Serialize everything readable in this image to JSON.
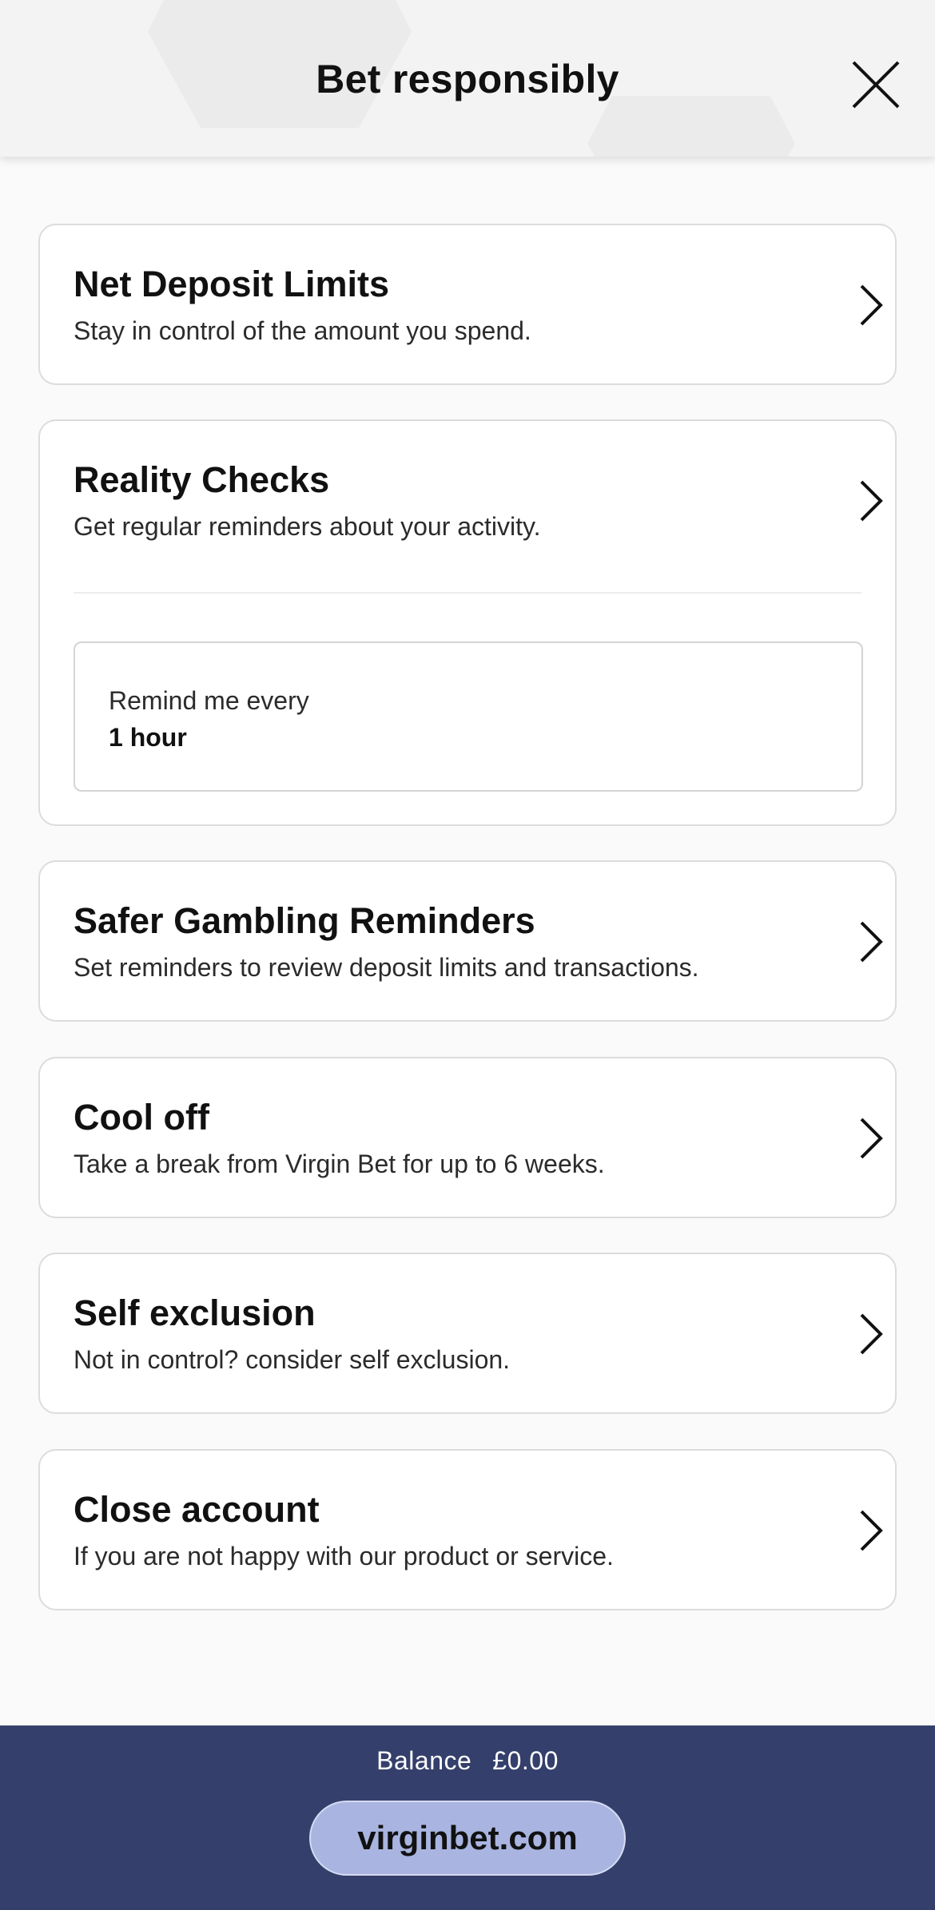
{
  "header": {
    "title": "Bet responsibly"
  },
  "cards": [
    {
      "title": "Net Deposit Limits",
      "desc": "Stay in control of the amount you spend."
    },
    {
      "title": "Reality Checks",
      "desc": "Get regular reminders about your activity.",
      "remind": {
        "label": "Remind me every",
        "value": "1 hour"
      }
    },
    {
      "title": "Safer Gambling Reminders",
      "desc": "Set reminders to review deposit limits and transactions."
    },
    {
      "title": "Cool off",
      "desc": "Take a break from Virgin Bet for up to 6 weeks."
    },
    {
      "title": "Self exclusion",
      "desc": "Not in control? consider self exclusion."
    },
    {
      "title": "Close account",
      "desc": "If you are not happy with our product or service."
    }
  ],
  "footer": {
    "balance_label": "Balance",
    "balance_value": "£0.00",
    "site": "virginbet.com"
  },
  "colors": {
    "footer_bg": "#343f6b",
    "pill_bg": "#a9b5e0"
  }
}
